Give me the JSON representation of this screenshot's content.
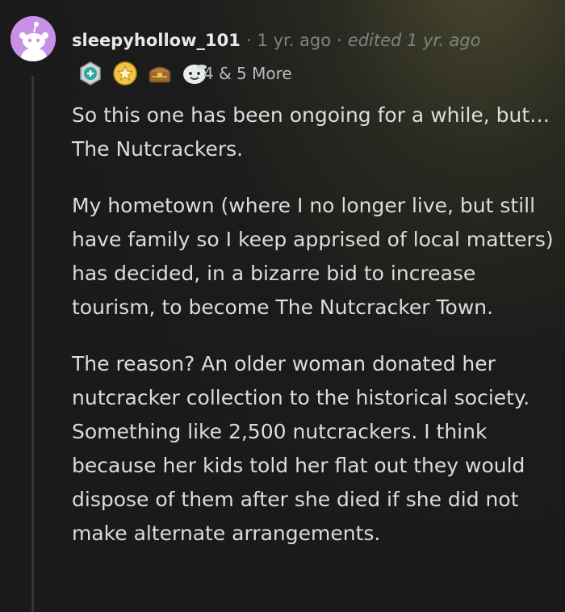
{
  "comment": {
    "username": "sleepyhollow_101",
    "separator": "·",
    "time_ago": "1 yr. ago",
    "edited": "edited 1 yr. ago",
    "award_more": "4 & 5 More",
    "award_icons": [
      "helpful-award-icon",
      "star-wreath-award-icon",
      "treasure-award-icon",
      "wholesome-award-icon"
    ],
    "paragraphs": [
      "So this one has been ongoing for a while, but… The Nutcrackers.",
      "My hometown (where I no longer live, but still have family so I keep apprised of local matters) has decided, in a bizarre bid to increase tourism, to become The Nutcracker Town.",
      "The reason? An older woman donated her nutcracker collection to the historical society. Something like 2,500 nutcrackers. I think because her kids told her flat out they would dispose of them after she died if she did not make alternate arrangements."
    ]
  },
  "colors": {
    "avatar_bg": "#c890e6",
    "background": "#1a1a1a",
    "text": "#d7dadc",
    "meta": "#818384"
  }
}
